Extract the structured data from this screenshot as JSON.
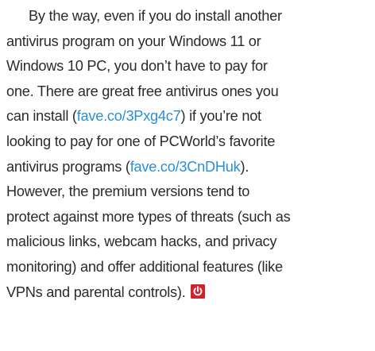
{
  "article": {
    "lines": [
      "By the way, even if you do install another",
      "antivirus program on your Windows 11 or",
      "Windows 10 PC, you don’t have to pay for",
      "one. There are great free antivirus ones you"
    ],
    "line5_prefix": "can install (",
    "link1": "fave.co/3Pxg4c7",
    "line5_suffix": ") if you’re not",
    "line6": "looking to pay for one of PCWorld’s favorite",
    "line7_prefix": "antivirus programs (",
    "link2": "fave.co/3CnDHuk",
    "line7_suffix": ").",
    "lines_after": [
      "However, the premium versions tend to",
      "protect against more types of threats (such as",
      "malicious links, webcam hacks, and privacy",
      "monitoring) and offer additional features (like"
    ],
    "last_line": "VPNs and parental controls).",
    "end_mark": {
      "icon": "power-icon",
      "color": "#d2232a"
    }
  },
  "colors": {
    "text": "#2b2b2b",
    "link": "#2a8fd6",
    "accent": "#d2232a"
  }
}
